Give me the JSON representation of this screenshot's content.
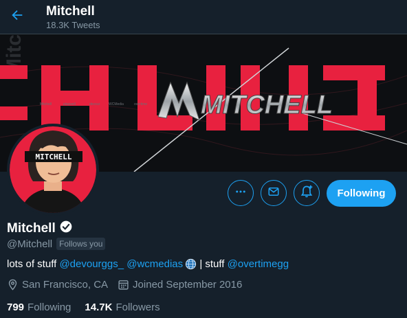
{
  "header": {
    "title": "Mitchell",
    "tweets_count": "18.3K Tweets"
  },
  "banner": {
    "logo_text": "MITCHELL",
    "colors": {
      "accent": "#e8213f",
      "dark": "#0d0f12"
    }
  },
  "avatar": {
    "name_bar_text": "MITCHELL"
  },
  "actions": {
    "more_icon": "more-horizontal-icon",
    "message_icon": "envelope-icon",
    "notify_icon": "bell-plus-icon",
    "following_label": "Following"
  },
  "profile": {
    "name": "Mitchell",
    "verified": true,
    "handle": "@Mitchell",
    "follows_you": "Follows you",
    "bio": {
      "text1": "lots of stuff ",
      "link1": "@devourggs_",
      "link2": "@wcmedias",
      "text2": " | stuff ",
      "link3": "@overtimegg"
    },
    "location": "San Francisco, CA",
    "joined": "Joined September 2016",
    "following_count": "799",
    "following_label": "Following",
    "followers_count": "14.7K",
    "followers_label": "Followers"
  },
  "colors": {
    "background": "#15202b",
    "accent": "#1da1f2",
    "secondary_text": "#8899a6"
  }
}
